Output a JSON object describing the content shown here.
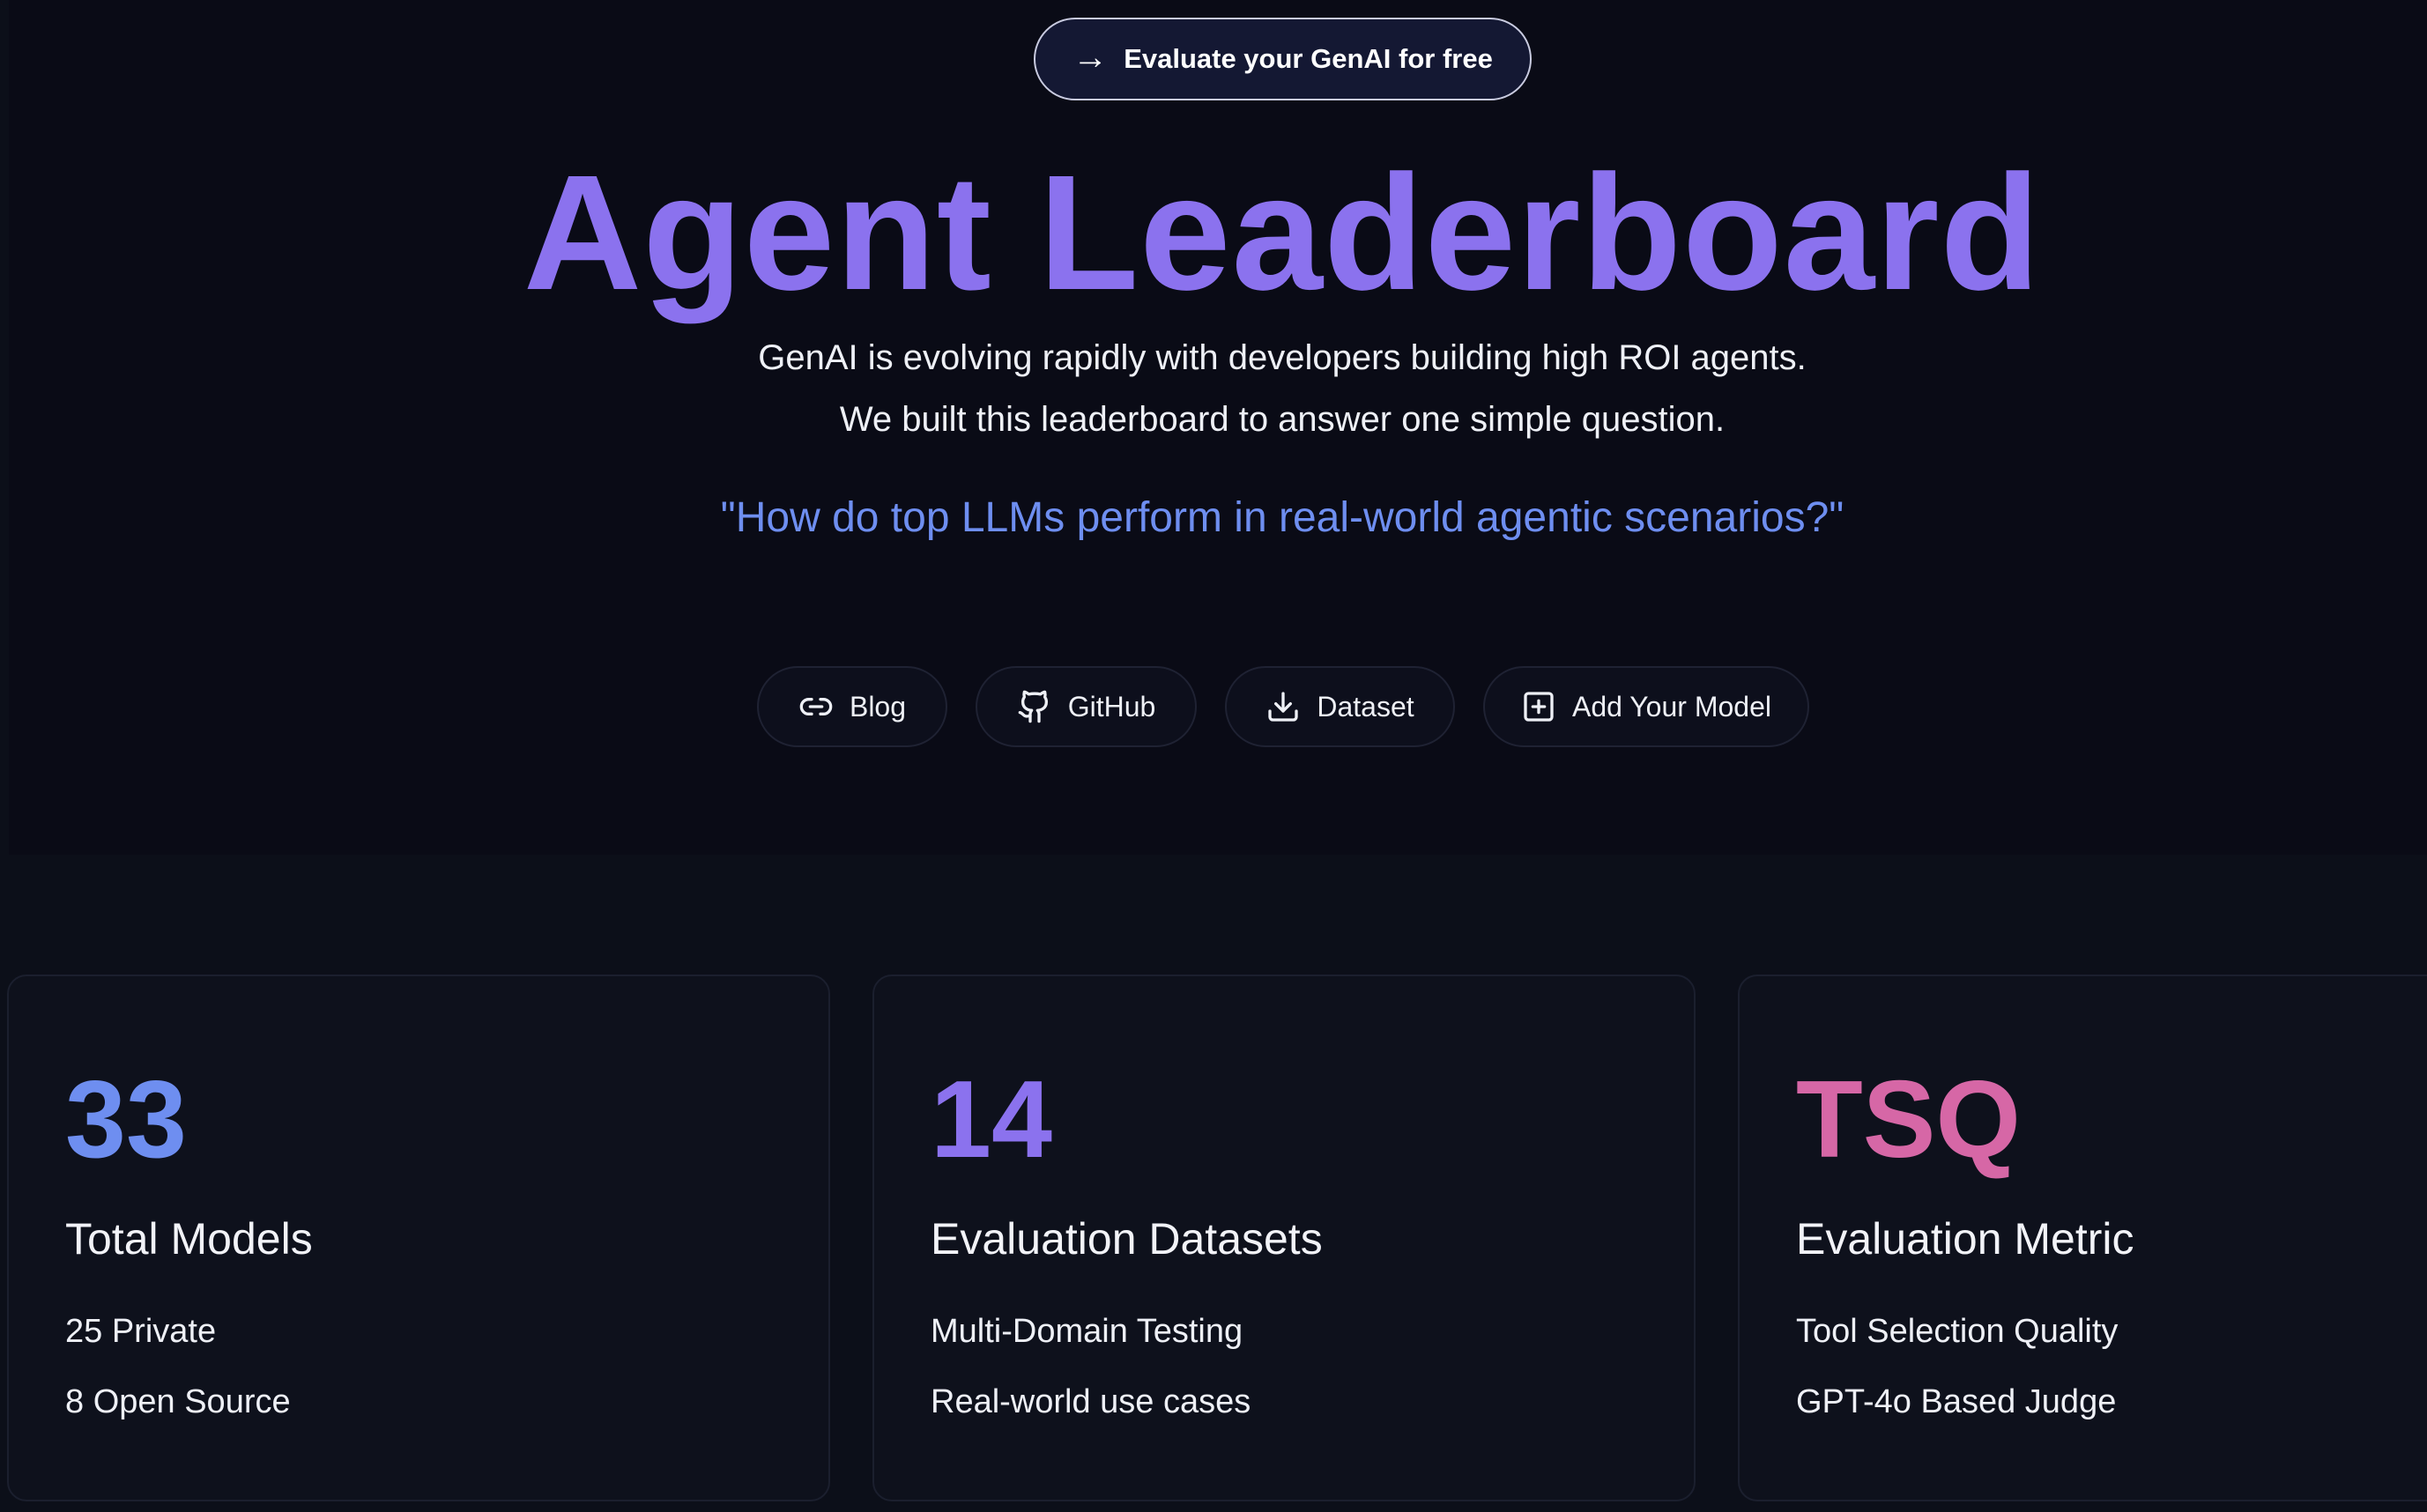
{
  "hero": {
    "cta_label": "Evaluate your GenAI for free",
    "cta_arrow": "→",
    "title": "Agent Leaderboard",
    "subtitle_line1": "GenAI is evolving rapidly with developers building high ROI agents.",
    "subtitle_line2": "We built this leaderboard to answer one simple question.",
    "question": "\"How do top LLMs perform in real-world agentic scenarios?\"",
    "links": [
      {
        "label": "Blog",
        "icon": "link-icon"
      },
      {
        "label": "GitHub",
        "icon": "github-icon"
      },
      {
        "label": "Dataset",
        "icon": "download-icon"
      },
      {
        "label": "Add Your Model",
        "icon": "plus-square-icon"
      }
    ]
  },
  "stats": [
    {
      "value": "33",
      "label": "Total Models",
      "line1": "25 Private",
      "line2": "8 Open Source",
      "color": "#6e8ef0"
    },
    {
      "value": "14",
      "label": "Evaluation Datasets",
      "line1": "Multi-Domain Testing",
      "line2": "Real-world use cases",
      "color": "#8b72ee"
    },
    {
      "value": "TSQ",
      "label": "Evaluation Metric",
      "line1": "Tool Selection Quality",
      "line2": "GPT-4o Based Judge",
      "color": "#d667a6"
    }
  ],
  "colors": {
    "title": "#8b72ee",
    "question": "#6e8ef0",
    "background": "#0c0f19",
    "hero_background": "#0a0b16"
  }
}
